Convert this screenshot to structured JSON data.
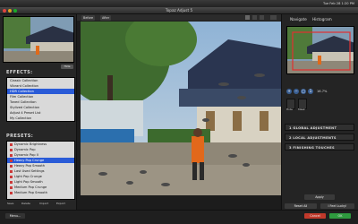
{
  "menubar": {
    "clock": "Tue Feb 28  1:20 PM"
  },
  "window": {
    "title": "Topaz Adjust 5"
  },
  "left": {
    "show_label": "Hide",
    "effects_heading": "EFFECTS:",
    "effects": [
      "Classic Collection",
      "Vibrant Collection",
      "HDR Collection",
      "Film Collection",
      "Toned Collection",
      "Stylized Collection",
      "Adjust 4 Preset List",
      "My Collection"
    ],
    "presets_heading": "PRESETS:",
    "presets": [
      "Dynamic Brightness",
      "Dynamic Pop",
      "Dynamic Pop II",
      "Heavy Pop Crunge",
      "Heavy Pop Smooth",
      "Last Used Settings",
      "Light Pop Crunge",
      "Light Pop Smooth",
      "Medium Pop Crunge",
      "Medium Pop Smooth"
    ],
    "buttons": [
      "Save",
      "Delete",
      "Import",
      "Export"
    ]
  },
  "center": {
    "tabs": [
      "Before",
      "After"
    ]
  },
  "right": {
    "tabs": [
      "Navigate",
      "Histogram"
    ],
    "zoom": "16.7%",
    "tools": [
      "Hide",
      "Mask"
    ],
    "sections": [
      "1 GLOBAL ADJUSTMENT",
      "2 LOCAL ADJUSTMENTS",
      "3 FINISHING TOUCHES"
    ],
    "apply": "Apply",
    "reset": "Reset All",
    "feel_lucky": "I Feel Lucky!"
  },
  "bottom": {
    "menu": "Menu...",
    "cancel": "Cancel",
    "ok": "OK"
  },
  "colors": {
    "accent": "#2a5bd7",
    "cancel": "#c0392b",
    "ok": "#2e9a3e"
  }
}
